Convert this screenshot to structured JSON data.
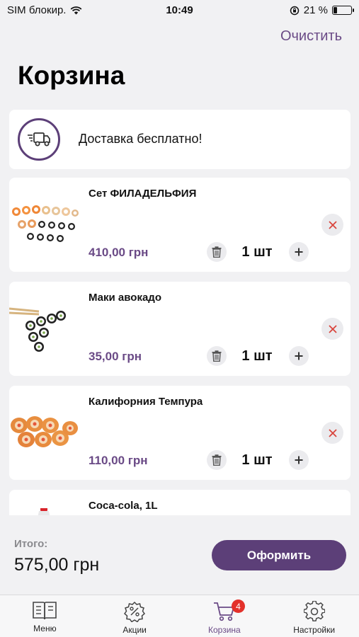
{
  "status_bar": {
    "carrier": "SIM блокир.",
    "time": "10:49",
    "battery": "21 %",
    "battery_level": 0.21
  },
  "header": {
    "clear_label": "Очистить",
    "title": "Корзина"
  },
  "delivery": {
    "text": "Доставка бесплатно!"
  },
  "items": [
    {
      "name": "Сет ФИЛАДЕЛЬФИЯ",
      "price": "410,00 грн",
      "qty": "1 шт"
    },
    {
      "name": "Маки авокадо",
      "price": "35,00 грн",
      "qty": "1 шт"
    },
    {
      "name": "Калифорния Темпура",
      "price": "110,00 грн",
      "qty": "1 шт"
    },
    {
      "name": "Coca-cola, 1L",
      "price": "",
      "qty": ""
    }
  ],
  "footer": {
    "total_label": "Итого:",
    "total_value": "575,00 грн",
    "checkout_label": "Оформить"
  },
  "tabbar": {
    "tabs": [
      {
        "label": "Меню",
        "icon": "menu-book-icon"
      },
      {
        "label": "Акции",
        "icon": "discount-gear-icon"
      },
      {
        "label": "Корзина",
        "icon": "cart-icon",
        "badge": "4",
        "active": true
      },
      {
        "label": "Настройки",
        "icon": "settings-gear-icon"
      }
    ]
  },
  "colors": {
    "accent": "#5c3f78",
    "price": "#6a4a86",
    "badge": "#e3312b",
    "remove_x": "#d9443c",
    "background": "#f1f1f3"
  }
}
